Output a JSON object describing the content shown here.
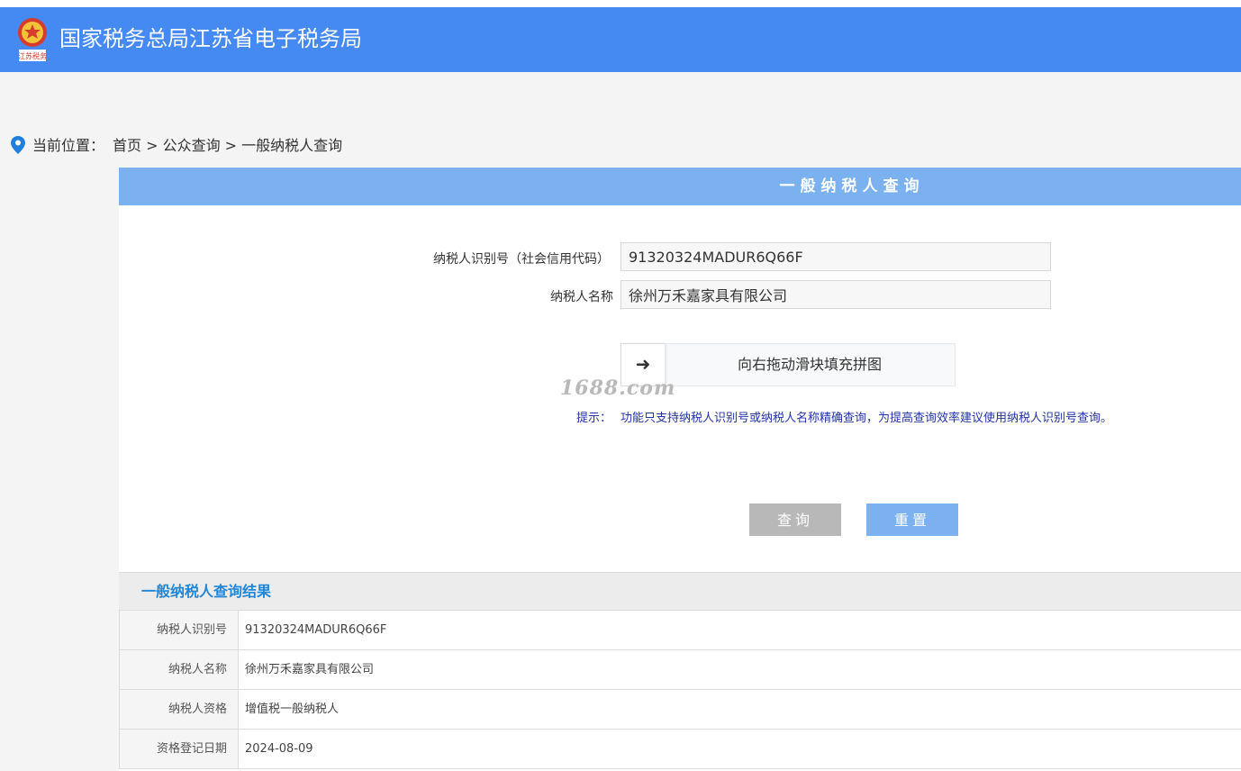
{
  "header": {
    "emblem_caption": "江苏税务",
    "site_title": "国家税务总局江苏省电子税务局",
    "brand_color": "#4589f2"
  },
  "breadcrumb": {
    "label": "当前位置：",
    "path": "首页 > 公众查询 > 一般纳税人查询"
  },
  "panel": {
    "title": "一般纳税人查询"
  },
  "form": {
    "taxpayer_id_label": "纳税人识别号（社会信用代码）",
    "taxpayer_id_value": "91320324MADUR6Q66F",
    "taxpayer_name_label": "纳税人名称",
    "taxpayer_name_value": "徐州万禾嘉家具有限公司"
  },
  "slider": {
    "handle_glyph": "➜",
    "text": "向右拖动滑块填充拼图"
  },
  "watermark": "1688.com",
  "hint": {
    "label": "提示：",
    "text": "功能只支持纳税人识别号或纳税人名称精确查询，为提高查询效率建议使用纳税人识别号查询。"
  },
  "buttons": {
    "query": "查询",
    "reset": "重置"
  },
  "result": {
    "title": "一般纳税人查询结果",
    "rows": [
      {
        "key": "纳税人识别号",
        "value": "91320324MADUR6Q66F"
      },
      {
        "key": "纳税人名称",
        "value": "徐州万禾嘉家具有限公司"
      },
      {
        "key": "纳税人资格",
        "value": "增值税一般纳税人"
      },
      {
        "key": "资格登记日期",
        "value": "2024-08-09"
      }
    ]
  }
}
